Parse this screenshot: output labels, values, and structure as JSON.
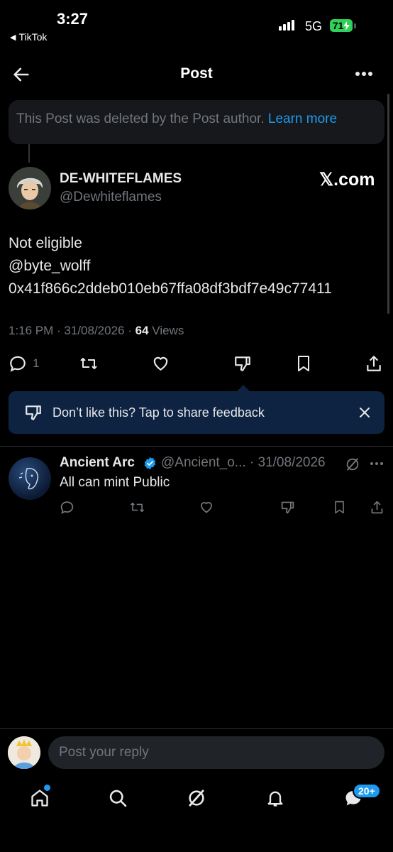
{
  "status_bar": {
    "time": "3:27",
    "back_app": "TikTok",
    "network": "5G",
    "battery": "71"
  },
  "header": {
    "title": "Post"
  },
  "deleted_notice": {
    "text": "This Post was deleted by the Post author.",
    "link": "Learn more"
  },
  "post": {
    "author_name": "DE-WHITEFLAMES",
    "author_handle": "@Dewhiteflames",
    "brand": "𝕏.com",
    "lines": [
      "Not eligible",
      "@byte_wolff",
      "0x41f866c2ddeb010eb67ffa08df3bdf7e49c77411"
    ],
    "time": "1:16 PM · 31/08/2026 ·",
    "views_count": "64",
    "views_label": "Views",
    "reply_count": "1"
  },
  "feedback": {
    "text": "Don’t like this? Tap to share feedback"
  },
  "reply": {
    "name": "Ancient Arc",
    "handle_date": "@Ancient_o... · 31/08/2026",
    "text": "All can mint Public"
  },
  "composer": {
    "placeholder": "Post your reply"
  },
  "nav": {
    "messages_badge": "20+"
  },
  "colors": {
    "accent": "#1d9bf0",
    "background": "#000000",
    "battery": "#30d158"
  }
}
